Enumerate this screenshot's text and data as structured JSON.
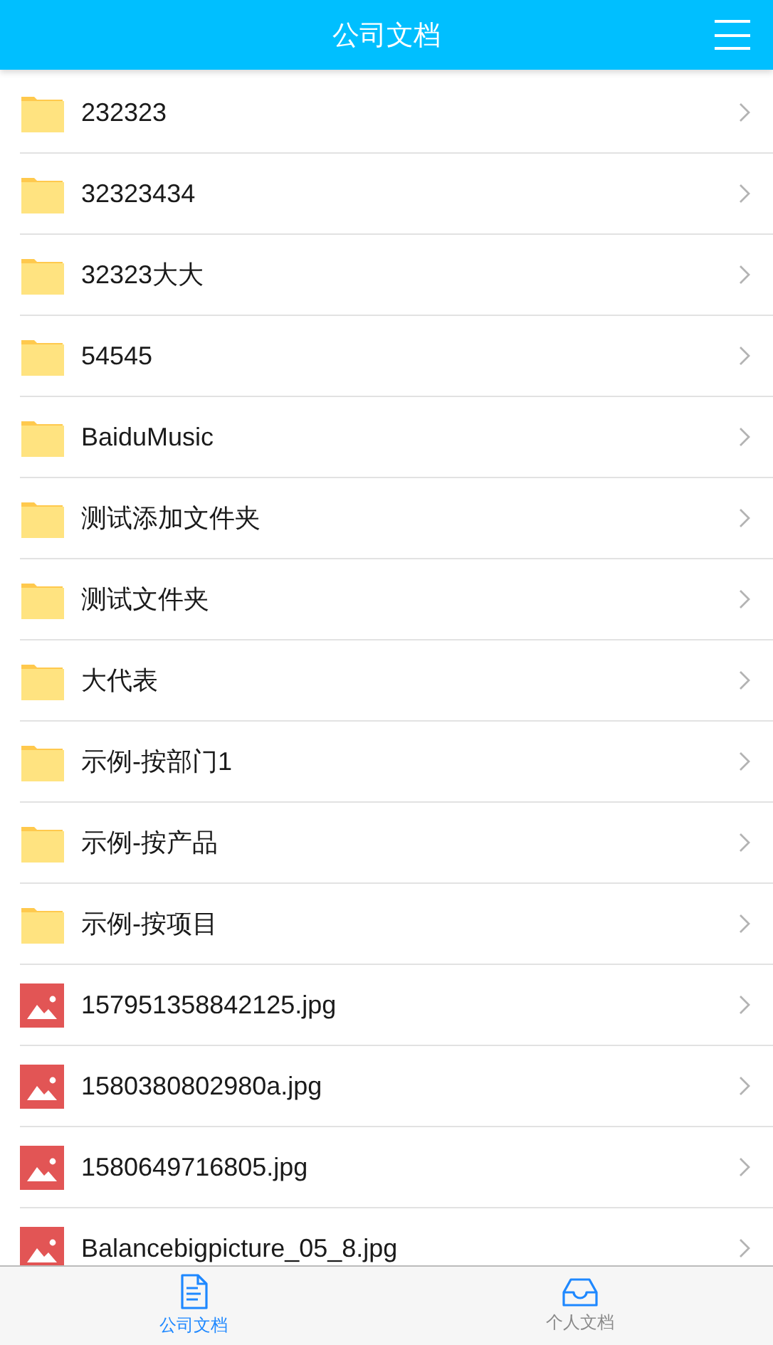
{
  "header": {
    "title": "公司文档"
  },
  "items": [
    {
      "kind": "folder",
      "name": "232323"
    },
    {
      "kind": "folder",
      "name": "32323434"
    },
    {
      "kind": "folder",
      "name": "32323大大"
    },
    {
      "kind": "folder",
      "name": "54545"
    },
    {
      "kind": "folder",
      "name": "BaiduMusic"
    },
    {
      "kind": "folder",
      "name": "测试添加文件夹"
    },
    {
      "kind": "folder",
      "name": "测试文件夹"
    },
    {
      "kind": "folder",
      "name": "大代表"
    },
    {
      "kind": "folder",
      "name": "示例-按部门1"
    },
    {
      "kind": "folder",
      "name": "示例-按产品"
    },
    {
      "kind": "folder",
      "name": "示例-按项目"
    },
    {
      "kind": "image",
      "name": "157951358842125.jpg"
    },
    {
      "kind": "image",
      "name": "1580380802980a.jpg"
    },
    {
      "kind": "image",
      "name": "1580649716805.jpg"
    },
    {
      "kind": "image",
      "name": "Balancebigpicture_05_8.jpg"
    }
  ],
  "tabs": [
    {
      "kind": "document",
      "label": "公司文档",
      "selected": true
    },
    {
      "kind": "inbox",
      "label": "个人文档",
      "selected": false
    }
  ]
}
